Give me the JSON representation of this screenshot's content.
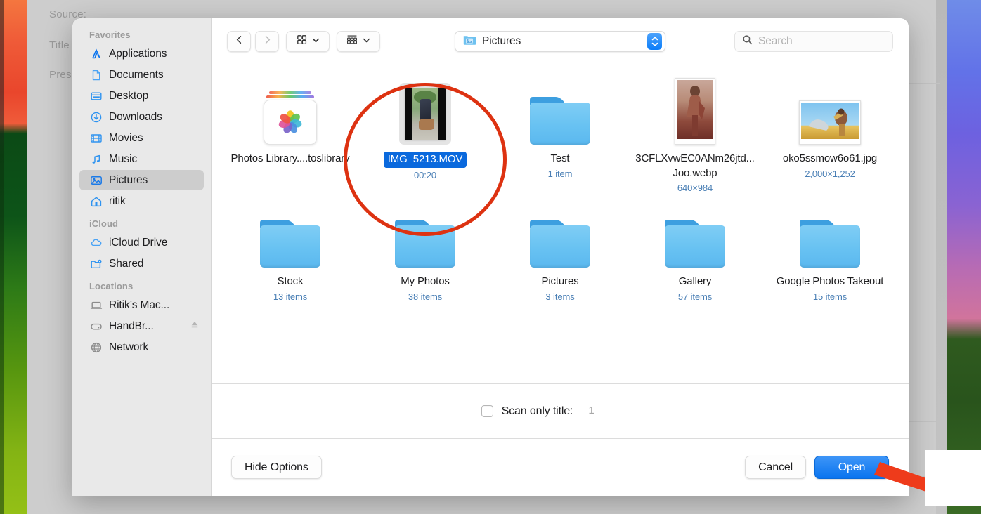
{
  "background_app": {
    "labels": [
      "Source:",
      "Title",
      "Pres"
    ]
  },
  "sidebar": {
    "groups": [
      {
        "title": "Favorites",
        "items": [
          {
            "label": "Applications",
            "icon": "applications-icon",
            "selected": false
          },
          {
            "label": "Documents",
            "icon": "document-icon",
            "selected": false
          },
          {
            "label": "Desktop",
            "icon": "desktop-icon",
            "selected": false
          },
          {
            "label": "Downloads",
            "icon": "downloads-icon",
            "selected": false
          },
          {
            "label": "Movies",
            "icon": "movies-icon",
            "selected": false
          },
          {
            "label": "Music",
            "icon": "music-icon",
            "selected": false
          },
          {
            "label": "Pictures",
            "icon": "pictures-icon",
            "selected": true
          },
          {
            "label": "ritik",
            "icon": "home-icon",
            "selected": false
          }
        ]
      },
      {
        "title": "iCloud",
        "items": [
          {
            "label": "iCloud Drive",
            "icon": "cloud-icon",
            "selected": false
          },
          {
            "label": "Shared",
            "icon": "shared-folder-icon",
            "selected": false
          }
        ]
      },
      {
        "title": "Locations",
        "items": [
          {
            "label": "Ritik’s Mac...",
            "icon": "laptop-icon",
            "selected": false
          },
          {
            "label": "HandBr...",
            "icon": "disk-icon",
            "selected": false,
            "eject": true
          },
          {
            "label": "Network",
            "icon": "globe-icon",
            "selected": false
          }
        ]
      }
    ]
  },
  "toolbar": {
    "back_icon": "chevron-left-icon",
    "forward_icon": "chevron-right-icon",
    "view_icon": "grid-view-icon",
    "group_icon": "group-view-icon",
    "path": {
      "label": "Pictures",
      "icon": "pictures-folder-icon"
    },
    "search": {
      "value": "",
      "placeholder": "Search",
      "icon": "search-icon"
    }
  },
  "files": [
    {
      "name": "Photos Library....toslibrary",
      "meta": "",
      "kind": "photos-library",
      "selected": false
    },
    {
      "name": "IMG_5213.MOV",
      "meta": "00:20",
      "kind": "movie",
      "selected": true
    },
    {
      "name": "Test",
      "meta": "1 item",
      "kind": "folder",
      "selected": false
    },
    {
      "name": "3CFLXvwEC0ANm26jtd...Joo.webp",
      "meta": "640×984",
      "kind": "image-portrait",
      "selected": false
    },
    {
      "name": "oko5ssmow6o61.jpg",
      "meta": "2,000×1,252",
      "kind": "image-landscape",
      "selected": false
    },
    {
      "name": "Stock",
      "meta": "13 items",
      "kind": "folder",
      "selected": false
    },
    {
      "name": "My Photos",
      "meta": "38 items",
      "kind": "folder",
      "selected": false
    },
    {
      "name": "Pictures",
      "meta": "3 items",
      "kind": "folder",
      "selected": false
    },
    {
      "name": "Gallery",
      "meta": "57 items",
      "kind": "folder",
      "selected": false
    },
    {
      "name": "Google Photos Takeout",
      "meta": "15 items",
      "kind": "folder",
      "selected": false
    }
  ],
  "accessory": {
    "checkbox_label": "Scan only title:",
    "checked": false,
    "title_value": "1"
  },
  "footer": {
    "hide_options_label": "Hide Options",
    "cancel_label": "Cancel",
    "open_label": "Open"
  },
  "colors": {
    "accent_blue": "#0a74ef",
    "selection_blue": "#0a69dd",
    "meta_blue": "#4a7fb5",
    "annotation_red": "#dd3211",
    "folder_blue": "#68c2f2"
  }
}
